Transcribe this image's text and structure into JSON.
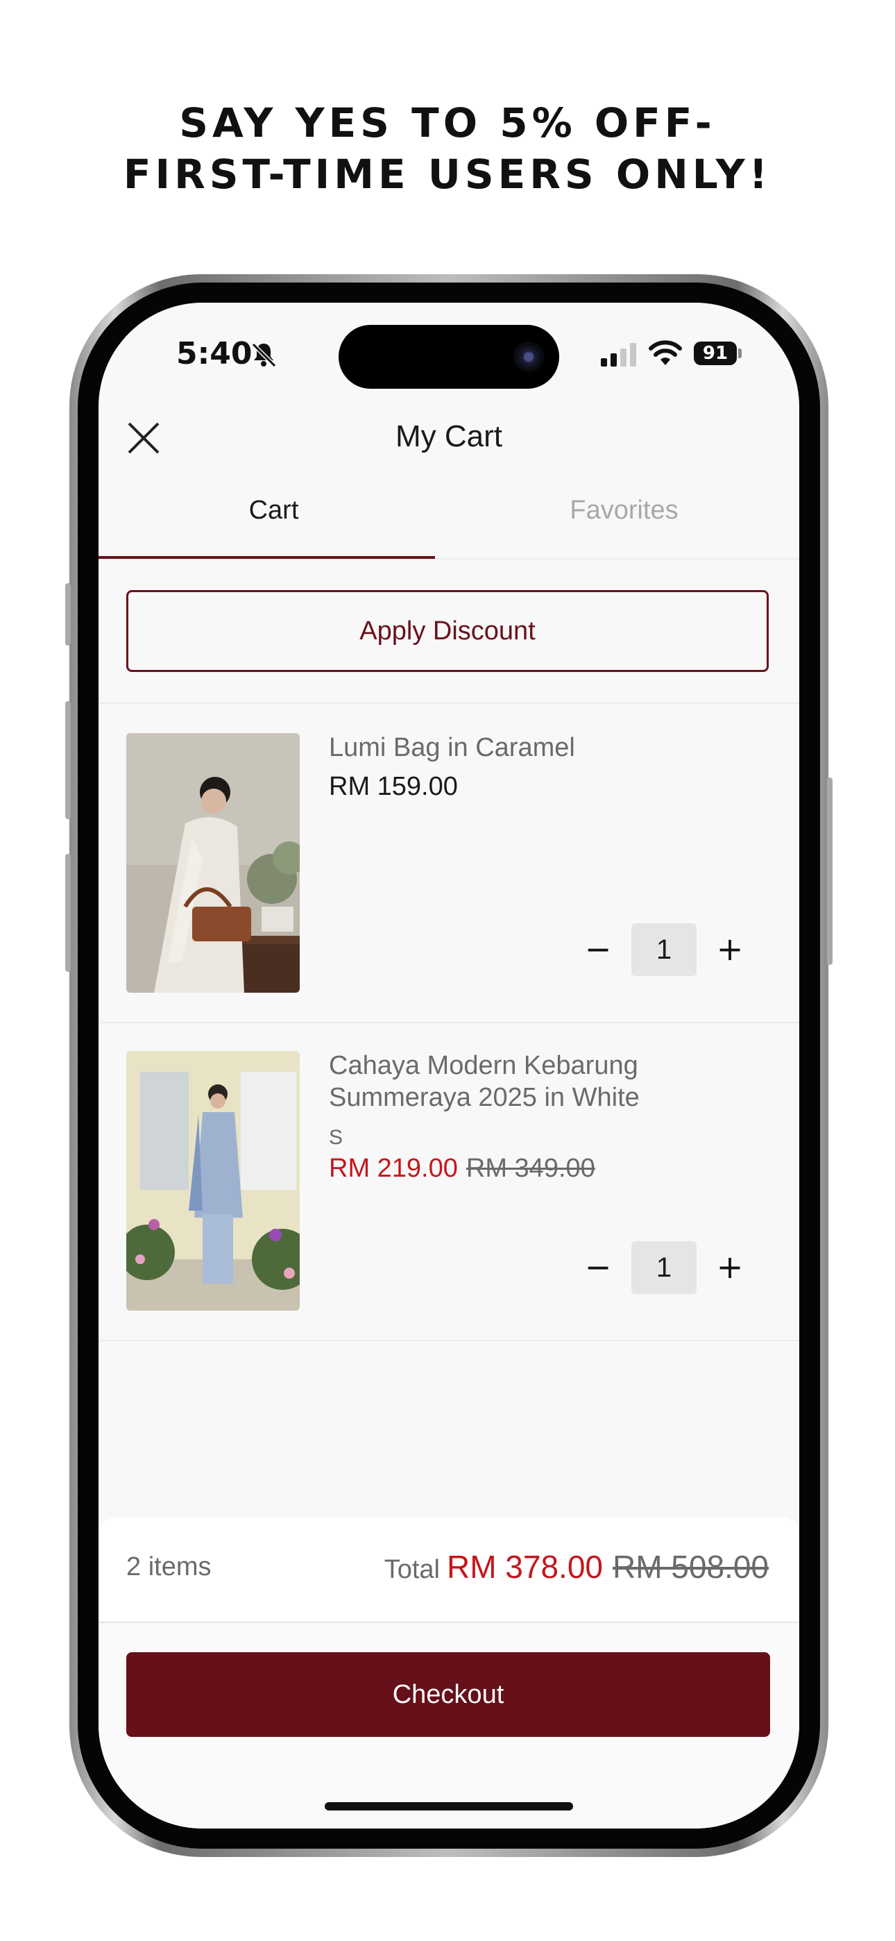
{
  "promo": {
    "line1": "SAY YES TO 5% OFF-",
    "line2": "FIRST-TIME USERS ONLY!"
  },
  "status_bar": {
    "time": "5:40",
    "battery": "91",
    "icons": [
      "bell-slash-icon",
      "cellular-signal-icon",
      "wifi-icon",
      "battery-icon"
    ]
  },
  "header": {
    "title": "My Cart",
    "close_icon": "close-icon"
  },
  "tabs": [
    {
      "label": "Cart",
      "active": true
    },
    {
      "label": "Favorites",
      "active": false
    }
  ],
  "discount": {
    "label": "Apply Discount"
  },
  "cart_items": [
    {
      "name": "Lumi Bag in Caramel",
      "price": "RM 159.00",
      "quantity": "1"
    },
    {
      "name": "Cahaya Modern Kebarung Summeraya 2025 in White",
      "variant": "S",
      "sale_price": "RM 219.00",
      "original_price": "RM 349.00",
      "quantity": "1"
    }
  ],
  "qty_controls": {
    "minus": "−",
    "plus": "+"
  },
  "summary": {
    "items_count": "2 items",
    "total_label": "Total",
    "total_sale": "RM 378.00",
    "total_original": "RM 508.00"
  },
  "checkout": {
    "label": "Checkout"
  },
  "colors": {
    "brand": "#661019",
    "sale": "#c4161c",
    "inactive_tab": "#a8a8a8"
  }
}
